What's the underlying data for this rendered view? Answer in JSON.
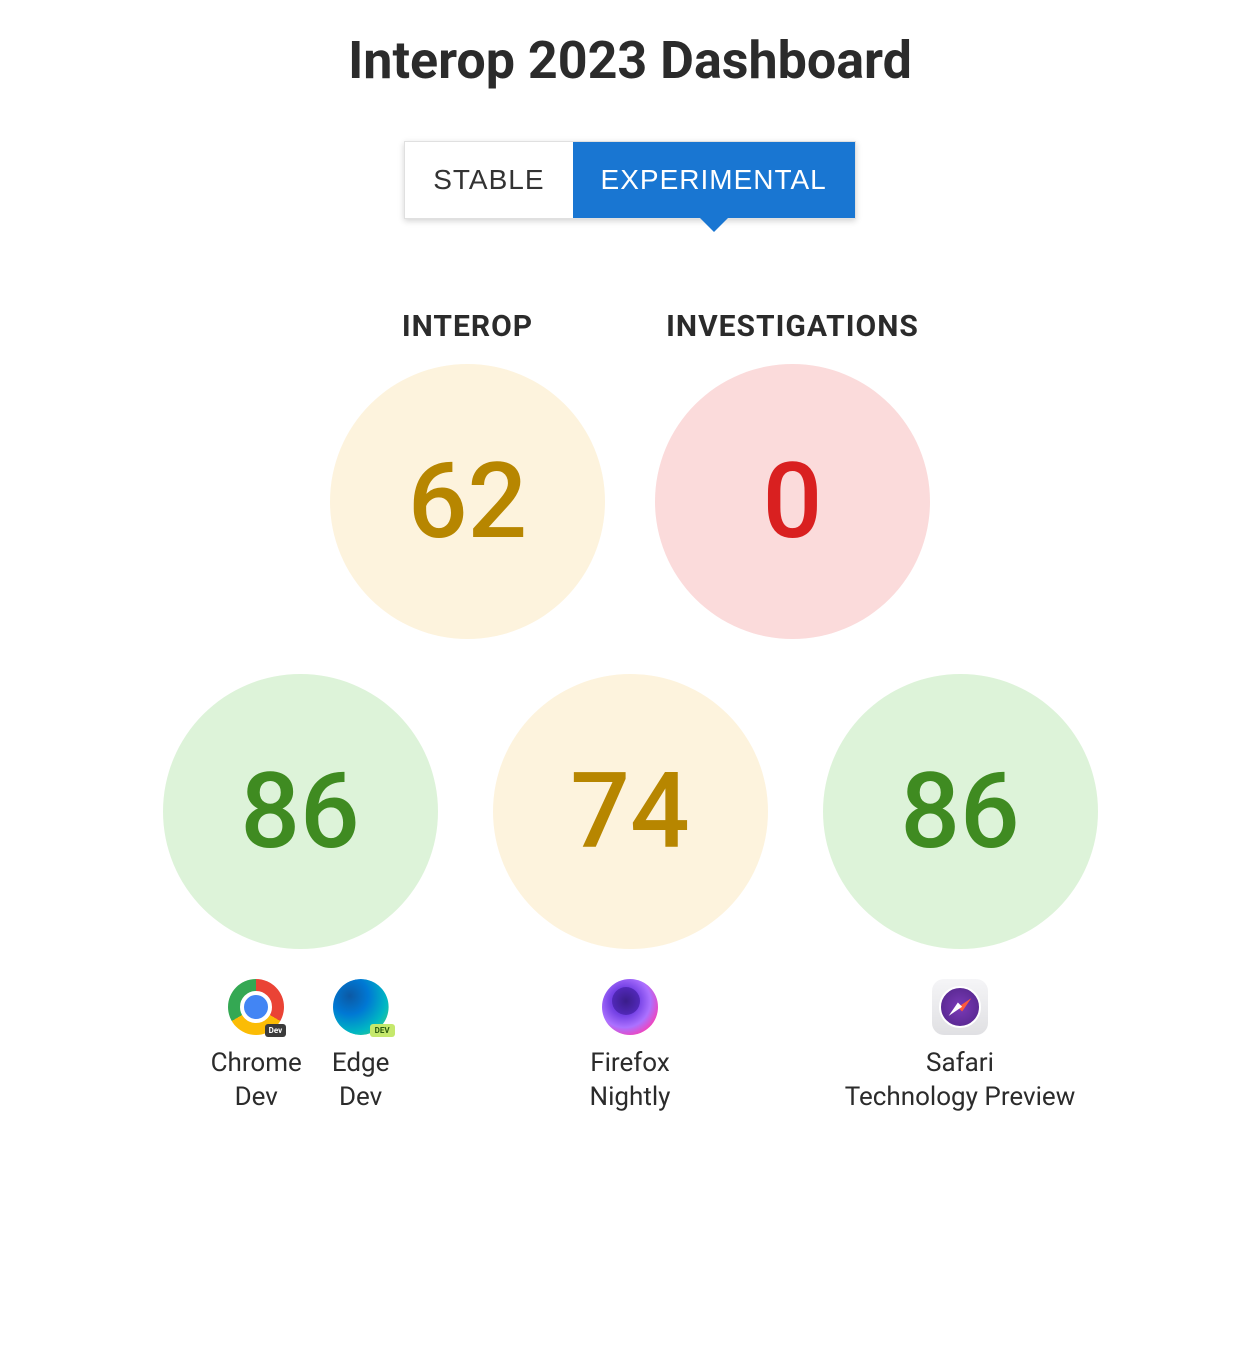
{
  "title": "Interop 2023 Dashboard",
  "tabs": {
    "stable": "STABLE",
    "experimental": "EXPERIMENTAL"
  },
  "top_metrics": {
    "interop": {
      "label": "INTEROP",
      "value": "62"
    },
    "investigations": {
      "label": "INVESTIGATIONS",
      "value": "0"
    }
  },
  "browsers": [
    {
      "score": "86",
      "items": [
        {
          "name": "Chrome",
          "variant": "Dev"
        },
        {
          "name": "Edge",
          "variant": "Dev"
        }
      ]
    },
    {
      "score": "74",
      "items": [
        {
          "name": "Firefox",
          "variant": "Nightly"
        }
      ]
    },
    {
      "score": "86",
      "items": [
        {
          "name": "Safari",
          "variant": "Technology Preview"
        }
      ]
    }
  ]
}
